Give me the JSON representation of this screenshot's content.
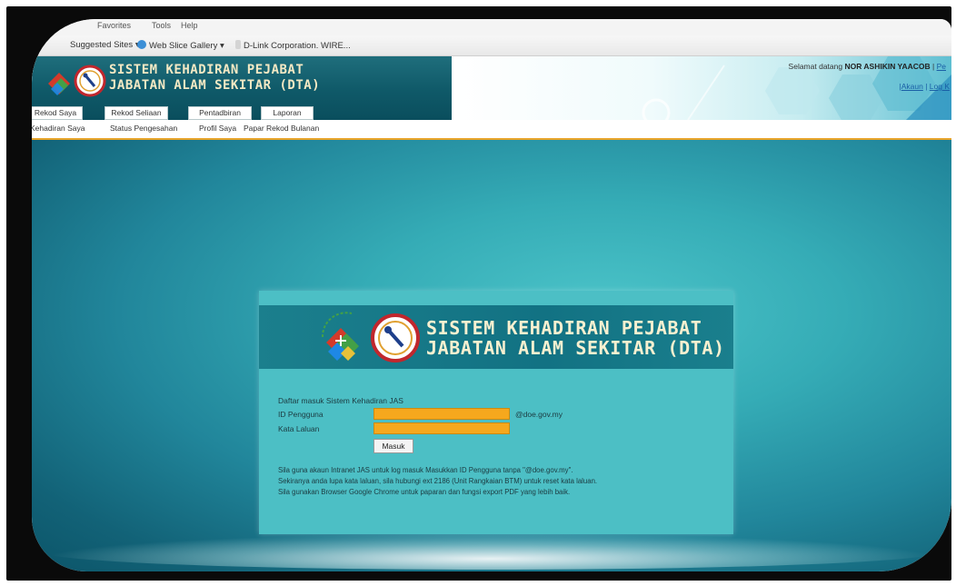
{
  "browser": {
    "menu": [
      "Favorites",
      "Tools",
      "Help"
    ],
    "favorites": [
      {
        "label": "Suggested Sites ▾",
        "icon": "suggested-sites-icon"
      },
      {
        "label": "Web Slice Gallery ▾",
        "icon": "web-slice-icon"
      },
      {
        "label": "D-Link Corporation. WIRE...",
        "icon": "dlink-icon"
      }
    ]
  },
  "header": {
    "title_line1": "SISTEM KEHADIRAN PEJABAT",
    "title_line2": "JABATAN ALAM SEKITAR (DTA)",
    "welcome_prefix": "Selamat datang",
    "user_name": "NOR ASHIKIN YAACOB",
    "user_link": "Pe",
    "links": [
      "Akaun",
      "Log K"
    ]
  },
  "tabs": [
    "Rekod Saya",
    "Rekod Seliaan",
    "Pentadbiran",
    "Laporan"
  ],
  "subnav": [
    "Kehadiran Saya",
    "Status Pengesahan",
    "Profil Saya",
    "Papar Rekod Bulanan"
  ],
  "login": {
    "title_line1": "SISTEM KEHADIRAN PEJABAT",
    "title_line2": "JABATAN ALAM SEKITAR (DTA)",
    "heading": "Daftar masuk Sistem Kehadiran JAS",
    "user_label": "ID Pengguna",
    "user_value": "",
    "domain_suffix": "@doe.gov.my",
    "password_label": "Kata Laluan",
    "password_value": "",
    "submit_label": "Masuk",
    "notes": [
      "Sila guna akaun Intranet JAS untuk log masuk Masukkan ID Pengguna tanpa \"@doe.gov.my\".",
      "Sekiranya anda lupa kata laluan, sila hubungi ext 2186 (Unit Rangkaian BTM) untuk reset kata laluan.",
      "Sila gunakan Browser Google Chrome untuk paparan dan fungsi export PDF yang lebih baik."
    ]
  },
  "colors": {
    "header_teal": "#0f5968",
    "title_cream": "#f4e9c4",
    "accent_orange": "#f6a81d",
    "panel_teal": "#4cbfc5",
    "link_blue": "#1a5fa6"
  }
}
